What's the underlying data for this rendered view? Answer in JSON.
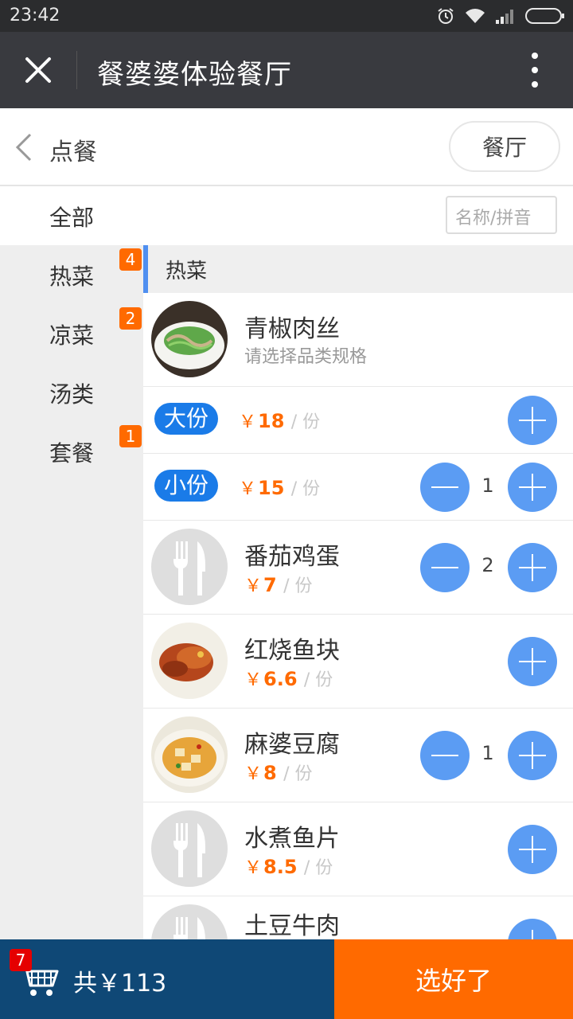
{
  "status_bar": {
    "time": "23:42"
  },
  "titlebar": {
    "title": "餐婆婆体验餐厅"
  },
  "subheader": {
    "back_label": "点餐",
    "restaurant_button": "餐厅"
  },
  "filter": {
    "all_label": "全部",
    "search_placeholder": "名称/拼音"
  },
  "categories": [
    {
      "label": "热菜",
      "badge": "4"
    },
    {
      "label": "凉菜",
      "badge": "2"
    },
    {
      "label": "汤类",
      "badge": ""
    },
    {
      "label": "套餐",
      "badge": "1"
    }
  ],
  "section": {
    "title": "热菜"
  },
  "currency": "￥",
  "unit": "/ 份",
  "dishes": [
    {
      "name": "青椒肉丝",
      "hint": "请选择品类规格"
    },
    {
      "name": "番茄鸡蛋",
      "price": "7",
      "qty": "2"
    },
    {
      "name": "红烧鱼块",
      "price": "6.6"
    },
    {
      "name": "麻婆豆腐",
      "price": "8",
      "qty": "1"
    },
    {
      "name": "水煮鱼片",
      "price": "8.5"
    },
    {
      "name": "土豆牛肉"
    }
  ],
  "specs": [
    {
      "label": "大份",
      "price": "18"
    },
    {
      "label": "小份",
      "price": "15",
      "qty": "1"
    }
  ],
  "cart": {
    "count": "7",
    "total": "共￥113"
  },
  "checkout_label": "选好了",
  "colors": {
    "accent_orange": "#ff6a00",
    "accent_blue": "#5b9cf3",
    "cart_bar": "#0f4876",
    "titlebar": "#393a3f"
  }
}
